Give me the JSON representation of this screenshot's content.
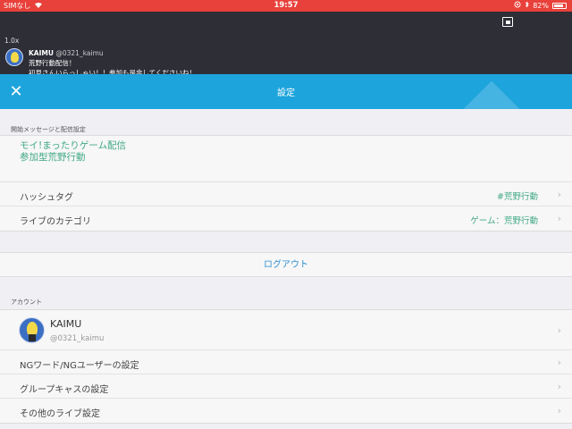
{
  "status_bar": {
    "carrier": "SIMなし",
    "time": "19:57",
    "battery": "82%",
    "battery_level": 0.82
  },
  "stream": {
    "speed": "1.0x",
    "comment": {
      "user": "KAIMU",
      "handle": "@0321_kaimu",
      "line1": "荒野行動配信！",
      "line2": "初見さんいらっしゃい！！参加も是非してくださいね！"
    }
  },
  "navbar": {
    "title": "設定",
    "close_icon": "close-icon"
  },
  "sections": {
    "message_header": "開始メッセージと配信設定",
    "message_line1": "モイ!まったりゲーム配信",
    "message_line2": "参加型荒野行動",
    "hashtag_label": "ハッシュタグ",
    "hashtag_value": "#荒野行動",
    "category_label": "ライブのカテゴリ",
    "category_value": "ゲーム：荒野行動",
    "logout_label": "ログアウト",
    "account_header": "アカウント",
    "account_name": "KAIMU",
    "account_handle": "@0321_kaimu",
    "ng_label": "NGワード/NGユーザーの設定",
    "group_label": "グループキャスの設定",
    "other_label": "その他のライブ設定"
  },
  "colors": {
    "status_bar": "#e8403a",
    "navbar": "#1ea4dc",
    "accent_green": "#41a886",
    "link_blue": "#2f8fd0"
  }
}
